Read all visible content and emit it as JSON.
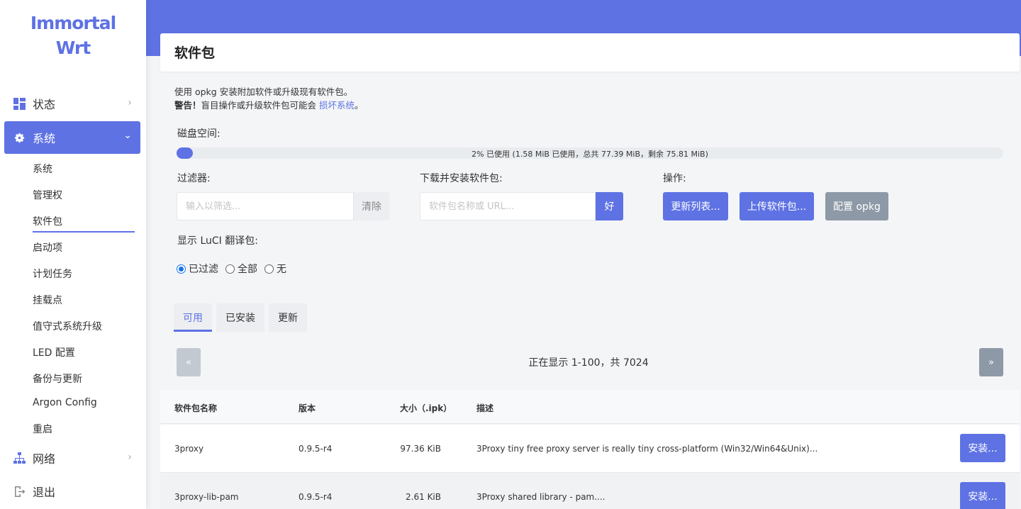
{
  "logo": {
    "line1": "Immortal",
    "line2": "Wrt"
  },
  "sidebar": {
    "status": "状态",
    "system": "系统",
    "network": "网络",
    "logout": "退出",
    "sub": [
      "系统",
      "管理权",
      "软件包",
      "启动项",
      "计划任务",
      "挂载点",
      "值守式系统升级",
      "LED 配置",
      "备份与更新",
      "Argon Config",
      "重启"
    ]
  },
  "page": {
    "title": "软件包",
    "desc1": "使用 opkg 安装附加软件或升级现有软件包。",
    "warn_label": "警告！",
    "warn_text": "盲目操作或升级软件包可能会 ",
    "warn_link": "损坏系统",
    "warn_end": "。"
  },
  "disk": {
    "label": "磁盘空间:",
    "percent": 2,
    "text": "2% 已使用 (1.58 MiB 已使用，总共 77.39 MiB，剩余 75.81 MiB)"
  },
  "filter": {
    "label": "过滤器:",
    "placeholder": "输入以筛选...",
    "clear": "清除"
  },
  "download": {
    "label": "下载并安装软件包:",
    "placeholder": "软件包名称或 URL...",
    "ok": "好"
  },
  "actions": {
    "label": "操作:",
    "update": "更新列表...",
    "upload": "上传软件包...",
    "config": "配置 opkg"
  },
  "luci": {
    "label": "显示 LuCI 翻译包:",
    "options": [
      "已过滤",
      "全部",
      "无"
    ],
    "selected": "已过滤"
  },
  "tabs": [
    "可用",
    "已安装",
    "更新"
  ],
  "pager": {
    "prev": "«",
    "next": "»",
    "text": "正在显示 1-100，共 7024"
  },
  "table": {
    "headers": [
      "软件包名称",
      "版本",
      "大小（.ipk）",
      "描述"
    ],
    "rows": [
      {
        "name": "3proxy",
        "version": "0.9.5-r4",
        "size": "97.36 KiB",
        "desc": "3Proxy tiny free proxy server is really tiny cross-platform (Win32/Win64&Unix)...",
        "action": "安装..."
      },
      {
        "name": "3proxy-lib-pam",
        "version": "0.9.5-r4",
        "size": "2.61 KiB",
        "desc": "3Proxy shared library - pam....",
        "action": "安装..."
      }
    ]
  }
}
